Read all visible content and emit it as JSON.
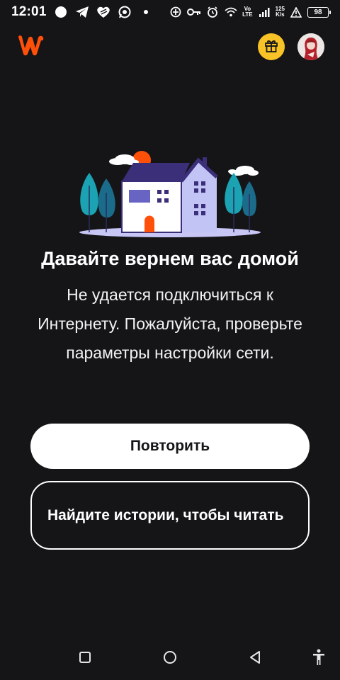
{
  "status_bar": {
    "time": "12:01",
    "net_speed_value": "125",
    "net_speed_unit": "K/s",
    "network_type_top": "Vo",
    "network_type_bottom": "LTE",
    "battery": "98"
  },
  "header": {
    "logo_icon": "wattpad-logo",
    "gift_icon": "gift-icon",
    "avatar_icon": "user-avatar"
  },
  "offline": {
    "headline": "Давайте вернем вас домой",
    "message": "Не удается подключиться к Интернету. Пожалуйста, проверьте параметры настройки сети.",
    "retry_label": "Повторить",
    "find_stories_label": "Найдите истории, чтобы читать"
  },
  "colors": {
    "background": "#151417",
    "brand_orange": "#ff500a",
    "gift_yellow": "#f7c326",
    "house_purple": "#3b2f7a",
    "tree_teal": "#1ba3b3"
  },
  "nav_bar": {
    "recents_icon": "square-recents-icon",
    "home_icon": "circle-home-icon",
    "back_icon": "triangle-back-icon",
    "accessibility_icon": "accessibility-icon"
  }
}
